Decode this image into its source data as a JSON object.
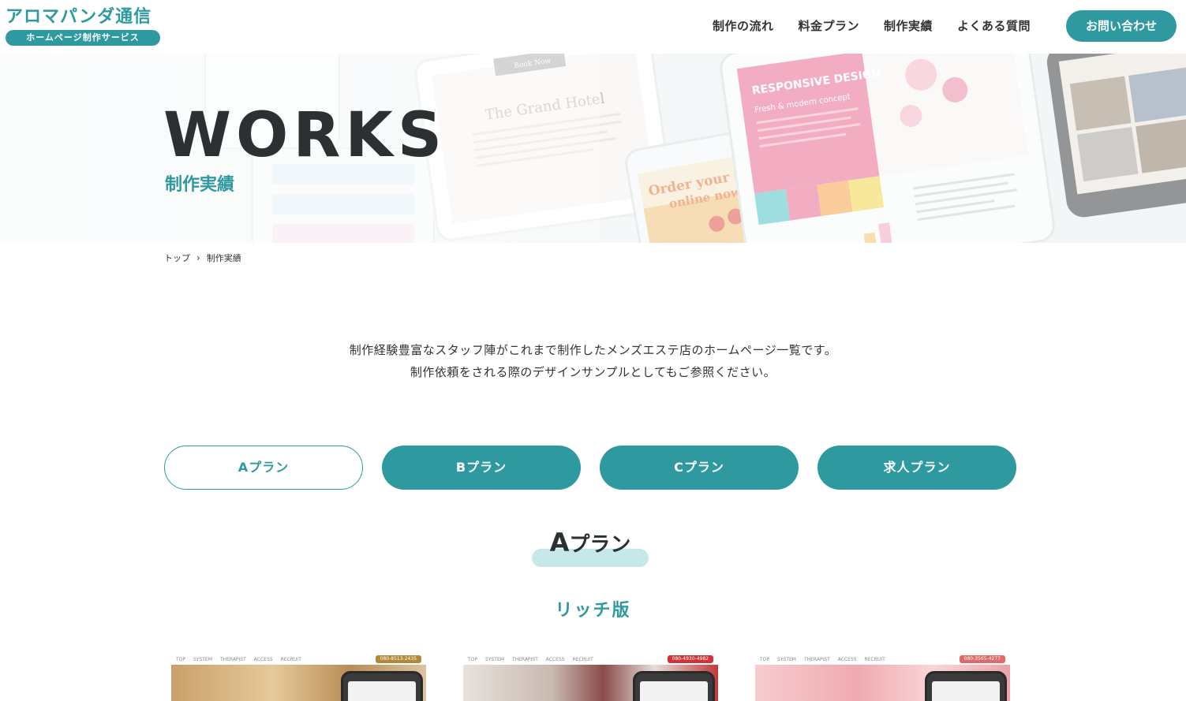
{
  "header": {
    "logo_title": "アロマパンダ通信",
    "logo_subtitle": "ホームページ制作サービス",
    "nav": [
      "制作の流れ",
      "料金プラン",
      "制作実績",
      "よくある質問"
    ],
    "contact_label": "お問い合わせ"
  },
  "hero": {
    "title": "WORKS",
    "subtitle": "制作実績",
    "art_texts": {
      "book_now": "Book Now",
      "grand_hotel": "The Grand Hotel",
      "order_food": "Order your food",
      "online_now": "online now!",
      "responsive": "RESPONSIVE DESIGN",
      "fresh": "Fresh & modern concept"
    }
  },
  "breadcrumb": {
    "home": "トップ",
    "separator": "›",
    "current": "制作実績"
  },
  "intro": {
    "line1": "制作経験豊富なスタッフ陣がこれまで制作したメンズエステ店のホームページ一覧です。",
    "line2": "制作依頼をされる際のデザインサンプルとしてもご参照ください。"
  },
  "tabs": [
    {
      "label": "Aプラン",
      "active": true
    },
    {
      "label": "Bプラン",
      "active": false
    },
    {
      "label": "Cプラン",
      "active": false
    },
    {
      "label": "求人プラン",
      "active": false
    }
  ],
  "section": {
    "title_letter": "A",
    "title_rest": "プラン",
    "subtitle": "リッチ版"
  },
  "thumbnails": [
    {
      "nav": [
        "TOP",
        "SYSTEM",
        "THERAPIST",
        "ACCESS",
        "RECRUIT"
      ],
      "tel": "080-8513-2435",
      "tel_color": "#b08a3a",
      "bg": "#d8b483"
    },
    {
      "nav": [
        "TOP",
        "SYSTEM",
        "THERAPIST",
        "ACCESS",
        "RECRUIT"
      ],
      "tel": "080-4930-4982",
      "tel_color": "#d0343a",
      "bg": "#d7c9c4"
    },
    {
      "nav": [
        "TOP",
        "SYSTEM",
        "THERAPIST",
        "ACCESS",
        "RECRUIT"
      ],
      "tel": "080-3565-4277",
      "tel_color": "#e06a6a",
      "bg": "#f0b9bd"
    }
  ],
  "colors": {
    "accent": "#2e9aa0",
    "accent_light": "#c5e8ea",
    "text_dark": "#2b3132"
  }
}
